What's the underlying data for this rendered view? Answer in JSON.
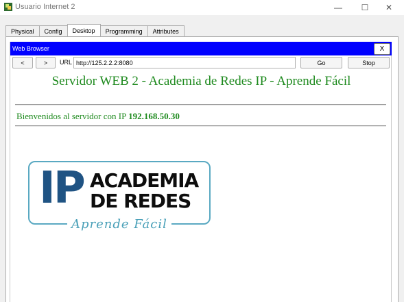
{
  "window": {
    "title": "Usuario Internet 2",
    "minimize_glyph": "—",
    "maximize_glyph": "☐",
    "close_glyph": "✕"
  },
  "tabs": [
    {
      "label": "Physical",
      "active": false
    },
    {
      "label": "Config",
      "active": false
    },
    {
      "label": "Desktop",
      "active": true
    },
    {
      "label": "Programming",
      "active": false
    },
    {
      "label": "Attributes",
      "active": false
    }
  ],
  "browser": {
    "title": "Web Browser",
    "close_label": "X",
    "back_label": "<",
    "forward_label": ">",
    "url_label": "URL",
    "url_value": "http://125.2.2.2:8080",
    "go_label": "Go",
    "stop_label": "Stop"
  },
  "page": {
    "heading": "Servidor WEB 2 - Academia de Redes IP - Aprende Fácil",
    "welcome_text": "Bienvenidos al servidor con IP ",
    "server_ip": "192.168.50.30"
  },
  "logo": {
    "ip": "IP",
    "line1": "ACADEMIA",
    "line2": "DE REDES",
    "tagline": "Aprende Fácil"
  },
  "colors": {
    "browser_titlebar": "#0000ff",
    "heading_green": "#1e8a1e",
    "logo_blue": "#1f5383",
    "logo_teal": "#5aa9c2"
  }
}
